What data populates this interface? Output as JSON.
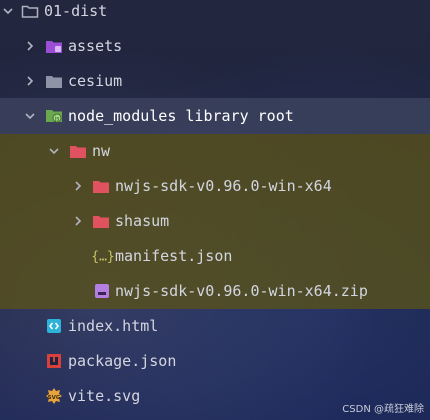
{
  "tree": {
    "root": {
      "label": "01-dist",
      "icon": "folder-outline-icon",
      "expanded": true
    },
    "items": [
      {
        "label": "assets",
        "icon": "purple-folder-icon",
        "expanded": false
      },
      {
        "label": "cesium",
        "icon": "grey-folder-icon",
        "expanded": false
      },
      {
        "label": "node_modules",
        "suffix": "library root",
        "icon": "green-node-folder-icon",
        "expanded": true,
        "selected": true
      },
      {
        "label": "nw",
        "icon": "red-folder-icon",
        "expanded": true
      },
      {
        "label": "nwjs-sdk-v0.96.0-win-x64",
        "icon": "red-folder-icon",
        "expanded": false
      },
      {
        "label": "shasum",
        "icon": "red-folder-icon",
        "expanded": false
      },
      {
        "label": "manifest.json",
        "icon": "json-braces-icon"
      },
      {
        "label": "nwjs-sdk-v0.96.0-win-x64.zip",
        "icon": "zip-archive-icon"
      },
      {
        "label": "index.html",
        "icon": "html-file-icon"
      },
      {
        "label": "package.json",
        "icon": "npm-package-icon"
      },
      {
        "label": "vite.svg",
        "icon": "svg-file-icon"
      }
    ]
  },
  "watermark": "CSDN @疏狂难除",
  "colors": {
    "selection_bg": "#3a405c",
    "highlight_bg": "#5a5218",
    "folder_red": "#e0525f",
    "folder_purple": "#9b4fd6",
    "folder_grey": "#8e93a6",
    "folder_green": "#6aa84f",
    "json_icon": "#c8c36a",
    "zip_icon": "#b37fe0",
    "html_icon": "#2bb3d9",
    "npm_icon": "#d9403a",
    "svg_icon": "#e8a33a"
  }
}
